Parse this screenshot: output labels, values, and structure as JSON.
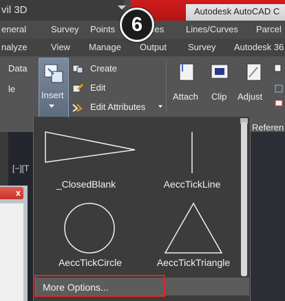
{
  "title_bar": {
    "app_name": "vil 3D",
    "product_title": "Autodesk AutoCAD C"
  },
  "step_badge": "6",
  "ribbon_tabs": [
    "eneral",
    "Survey",
    "Points",
    "ces",
    "Lines/Curves",
    "Parcel"
  ],
  "ribbon_tabs_2": [
    "nalyze",
    "View",
    "Manage",
    "Output",
    "Survey",
    "Autodesk 36"
  ],
  "ribbon": {
    "left_data": "Data",
    "left_le": "le",
    "insert": "Insert",
    "create": "Create",
    "edit": "Edit",
    "edit_attributes": "Edit Attributes",
    "attach": "Attach",
    "clip": "Clip",
    "adjust": "Adjust",
    "reference": "Referen"
  },
  "viewport_label": "[−][T",
  "dialog_close": "x",
  "block_gallery": [
    {
      "name": "_ClosedBlank",
      "icon": "closed-blank-arrow-icon"
    },
    {
      "name": "AeccTickLine",
      "icon": "tick-line-icon"
    },
    {
      "name": "AeccTickCircle",
      "icon": "tick-circle-icon"
    },
    {
      "name": "AeccTickTriangle",
      "icon": "tick-triangle-icon"
    }
  ],
  "more_options": "More Options...",
  "colors": {
    "highlight": "#d92b2b",
    "title_red": "#c81818"
  }
}
